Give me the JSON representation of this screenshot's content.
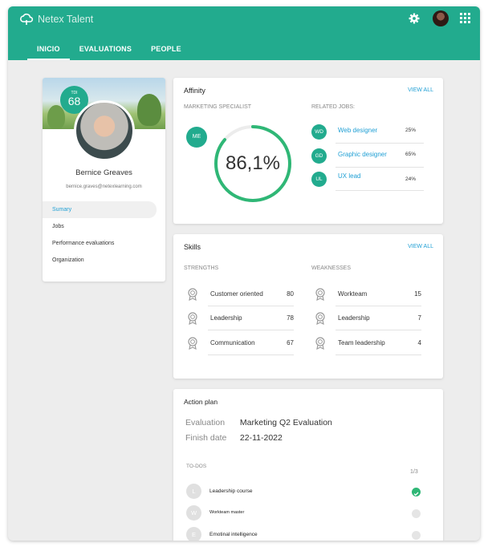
{
  "app": {
    "title": "Netex Talent"
  },
  "nav": {
    "tabs": [
      {
        "label": "INICIO"
      },
      {
        "label": "EVALUATIONS"
      },
      {
        "label": "PEOPLE"
      }
    ]
  },
  "profile": {
    "score_sublabel": "TDI",
    "score": "68",
    "name": "Bernice Greaves",
    "email": "bernice.graves@netexlearning.com",
    "menu": [
      {
        "label": "Sumary"
      },
      {
        "label": "Jobs"
      },
      {
        "label": "Performance evaluations"
      },
      {
        "label": "Organization"
      }
    ]
  },
  "affinity": {
    "title": "Affinity",
    "view_all": "VIEW ALL",
    "role_label": "MARKETING SPECIALIST",
    "role_initials": "ME",
    "percentage_text": "86,1%",
    "percentage_value": 86.1,
    "related_label": "RELATED JOBS:",
    "jobs": [
      {
        "initials": "WD",
        "name": "Web designer",
        "pct": "25%"
      },
      {
        "initials": "GD",
        "name": "Graphic designer",
        "pct": "65%"
      },
      {
        "initials": "UL",
        "name": "UX lead",
        "pct": "24%"
      }
    ]
  },
  "skills": {
    "title": "Skills",
    "view_all": "VIEW ALL",
    "strengths_label": "STRENGTHS",
    "weaknesses_label": "WEAKNESSES",
    "strengths": [
      {
        "name": "Customer oriented",
        "value": "80"
      },
      {
        "name": "Leadership",
        "value": "78"
      },
      {
        "name": "Communication",
        "value": "67"
      }
    ],
    "weaknesses": [
      {
        "name": "Workteam",
        "value": "15"
      },
      {
        "name": "Leadership",
        "value": "7"
      },
      {
        "name": "Team leadership",
        "value": "4"
      }
    ]
  },
  "action_plan": {
    "title": "Action plan",
    "evaluation_key": "Evaluation",
    "evaluation_value": "Marketing  Q2 Evaluation",
    "finish_key": "Finish date",
    "finish_value": "22-11-2022",
    "todos_label": "TO-DOS",
    "todos_count": "1/3",
    "todos": [
      {
        "initial": "L",
        "name": "Leadership course",
        "done": true
      },
      {
        "initial": "W",
        "name": "Workteam master",
        "done": false
      },
      {
        "initial": "E",
        "name": "Emotinal intelligence",
        "done": false
      }
    ]
  },
  "colors": {
    "primary": "#22ab8e",
    "link": "#1f9fd4",
    "ring": "#2fb776",
    "check_done": "#2fb776"
  }
}
